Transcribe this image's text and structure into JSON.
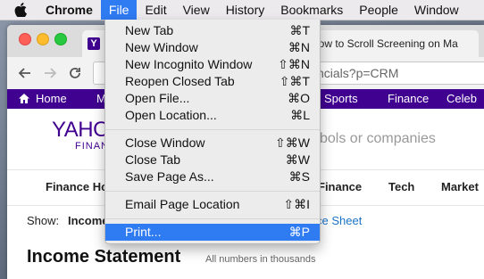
{
  "menubar": {
    "items": [
      "Chrome",
      "File",
      "Edit",
      "View",
      "History",
      "Bookmarks",
      "People",
      "Window"
    ]
  },
  "browser": {
    "tab_title": "How to Scroll Screening on Ma",
    "url": "ncials?p=CRM"
  },
  "yahoo_nav": {
    "home": "Home",
    "m": "M",
    "sports": "Sports",
    "finance": "Finance",
    "celeb": "Celeb"
  },
  "page": {
    "logo_top": "YAHO",
    "logo_bottom": "FINANC",
    "search_placeholder": "bols or companies",
    "subnav": [
      "Finance Ho",
      "Finance",
      "Tech",
      "Market"
    ],
    "show_label": "Show:",
    "show_value": "Income",
    "balance_link": "ce Sheet",
    "heading": "Income Statement",
    "note": "All numbers in thousands"
  },
  "file_menu": {
    "items": [
      {
        "label": "New Tab",
        "shortcut": "⌘T"
      },
      {
        "label": "New Window",
        "shortcut": "⌘N"
      },
      {
        "label": "New Incognito Window",
        "shortcut": "⇧⌘N"
      },
      {
        "label": "Reopen Closed Tab",
        "shortcut": "⇧⌘T"
      },
      {
        "label": "Open File...",
        "shortcut": "⌘O"
      },
      {
        "label": "Open Location...",
        "shortcut": "⌘L"
      },
      {
        "label": "Close Window",
        "shortcut": "⇧⌘W"
      },
      {
        "label": "Close Tab",
        "shortcut": "⌘W"
      },
      {
        "label": "Save Page As...",
        "shortcut": "⌘S"
      },
      {
        "label": "Email Page Location",
        "shortcut": "⇧⌘I"
      },
      {
        "label": "Print...",
        "shortcut": "⌘P"
      }
    ],
    "highlighted": "Print..."
  },
  "colors": {
    "menu_highlight": "#2f7bf2",
    "yahoo_purple": "#400090",
    "link_blue": "#1a73c8"
  }
}
